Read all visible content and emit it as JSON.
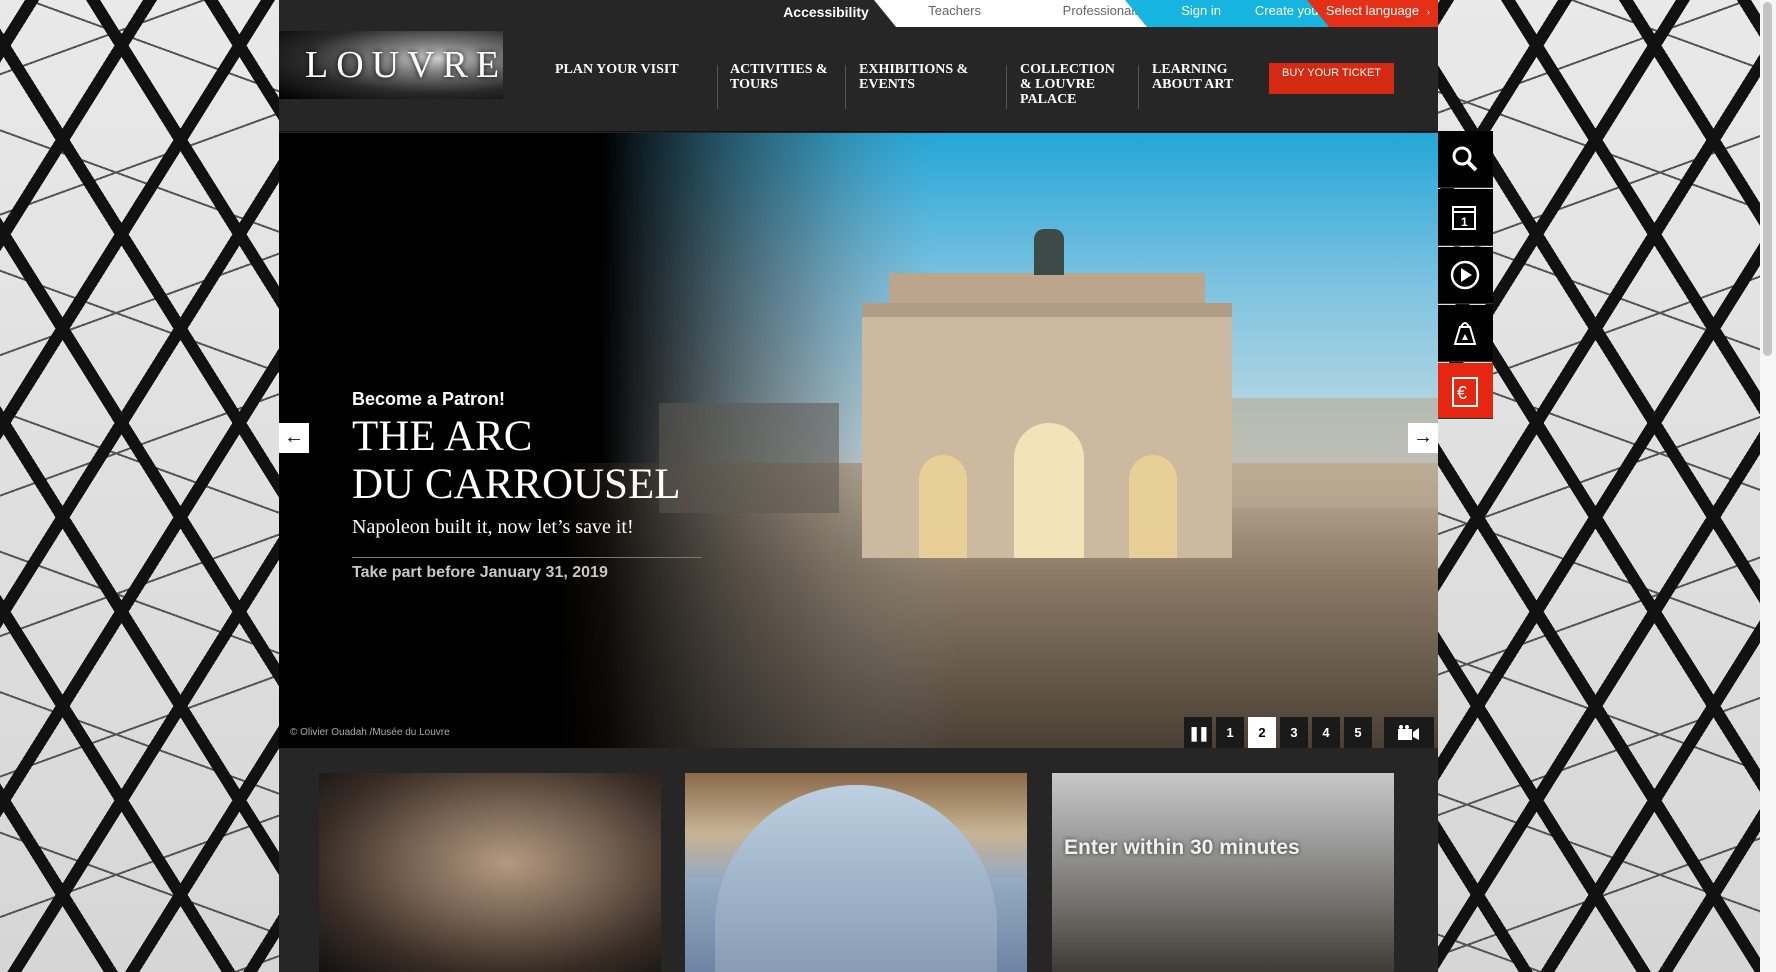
{
  "topbar": {
    "accessibility": "Accessibility",
    "teachers": "Teachers",
    "professionals": "Professionals & Associations",
    "sign_in": "Sign in",
    "create_account": "Create your account",
    "language": "Select language",
    "language_arrow": "›"
  },
  "header": {
    "logo_text": "LOUVRE",
    "nav": [
      {
        "label": "PLAN YOUR VISIT"
      },
      {
        "label": "ACTIVITIES & TOURS"
      },
      {
        "label": "EXHIBITIONS & EVENTS"
      },
      {
        "label": "COLLECTION & LOUVRE PALACE"
      },
      {
        "label": "LEARNING ABOUT ART"
      }
    ],
    "buy_ticket": "BUY YOUR TICKET"
  },
  "hero": {
    "kicker": "Become a Patron!",
    "title_line1": "THE ARC",
    "title_line2": "DU CARROUSEL",
    "subtitle": "Napoleon built it, now let’s save it!",
    "date": "Take part before January 31, 2019",
    "credit": "© Olivier Ouadah /Musée du Louvre",
    "prev_arrow": "←",
    "next_arrow": "→",
    "pager": {
      "pause": "❚❚",
      "pages": [
        "1",
        "2",
        "3",
        "4",
        "5"
      ],
      "active_page": "2",
      "video_icon": "video-camera-icon"
    }
  },
  "thumbnails": [
    {
      "label": ""
    },
    {
      "label": ""
    },
    {
      "label": "Enter within 30 minutes"
    }
  ],
  "side_toolbar": [
    {
      "icon": "search-icon"
    },
    {
      "icon": "calendar-icon"
    },
    {
      "icon": "play-icon"
    },
    {
      "icon": "shopping-bag-icon"
    },
    {
      "icon": "euro-ticket-icon"
    }
  ],
  "colors": {
    "accent_red": "#e43016",
    "accent_blue": "#16b5e0",
    "dark": "#262626"
  }
}
